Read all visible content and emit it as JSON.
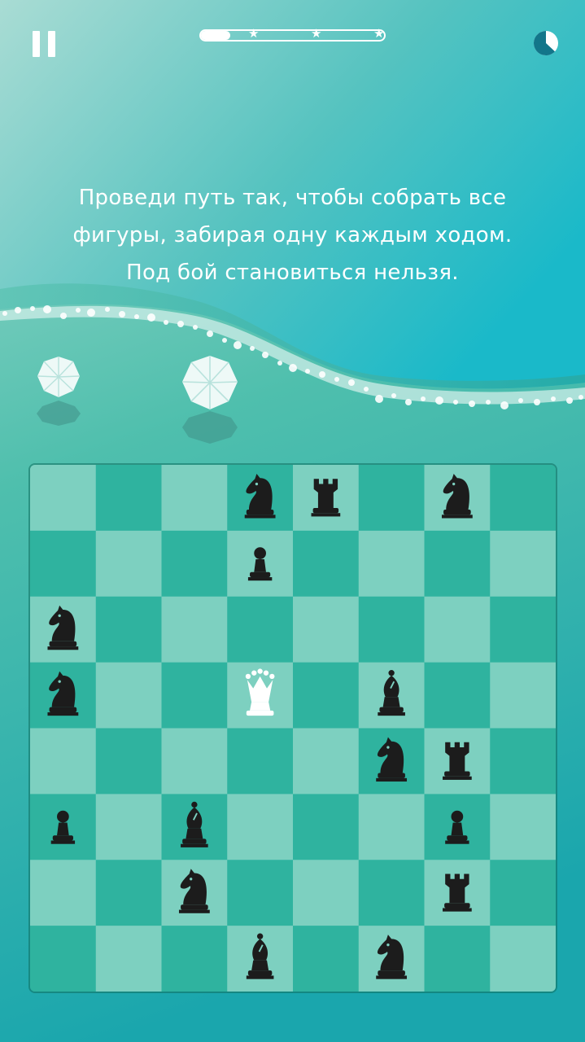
{
  "colors": {
    "light_square": "#7dd0c0",
    "dark_square": "#2fb39f",
    "black_piece": "#1c1c1c",
    "white_piece": "#ffffff"
  },
  "header": {
    "pause_icon": "pause-icon",
    "progress_fraction": 0.16,
    "progress_stars": [
      "star-icon",
      "star-icon",
      "star-icon"
    ],
    "timer_icon": "timer-icon"
  },
  "instruction": {
    "line1": "Проведи путь так, чтобы собрать все",
    "line2": "фигуры, забирая одну каждым ходом.",
    "line3": "Под бой становиться нельзя."
  },
  "gems": [
    {
      "icon": "gem-icon",
      "size": "small"
    },
    {
      "icon": "gem-icon",
      "size": "large"
    }
  ],
  "board": {
    "rows": 8,
    "cols": 8,
    "pieces": [
      {
        "row": 0,
        "col": 3,
        "type": "knight",
        "color": "black"
      },
      {
        "row": 0,
        "col": 4,
        "type": "rook",
        "color": "black"
      },
      {
        "row": 0,
        "col": 6,
        "type": "knight",
        "color": "black"
      },
      {
        "row": 1,
        "col": 3,
        "type": "pawn",
        "color": "black"
      },
      {
        "row": 2,
        "col": 0,
        "type": "knight",
        "color": "black"
      },
      {
        "row": 3,
        "col": 0,
        "type": "knight",
        "color": "black"
      },
      {
        "row": 3,
        "col": 3,
        "type": "queen",
        "color": "white"
      },
      {
        "row": 3,
        "col": 5,
        "type": "bishop",
        "color": "black"
      },
      {
        "row": 4,
        "col": 5,
        "type": "knight",
        "color": "black"
      },
      {
        "row": 4,
        "col": 6,
        "type": "rook",
        "color": "black"
      },
      {
        "row": 5,
        "col": 0,
        "type": "pawn",
        "color": "black"
      },
      {
        "row": 5,
        "col": 2,
        "type": "bishop",
        "color": "black"
      },
      {
        "row": 5,
        "col": 6,
        "type": "pawn",
        "color": "black"
      },
      {
        "row": 6,
        "col": 2,
        "type": "knight",
        "color": "black"
      },
      {
        "row": 6,
        "col": 6,
        "type": "rook",
        "color": "black"
      },
      {
        "row": 7,
        "col": 3,
        "type": "bishop",
        "color": "black"
      },
      {
        "row": 7,
        "col": 5,
        "type": "knight",
        "color": "black"
      }
    ]
  }
}
